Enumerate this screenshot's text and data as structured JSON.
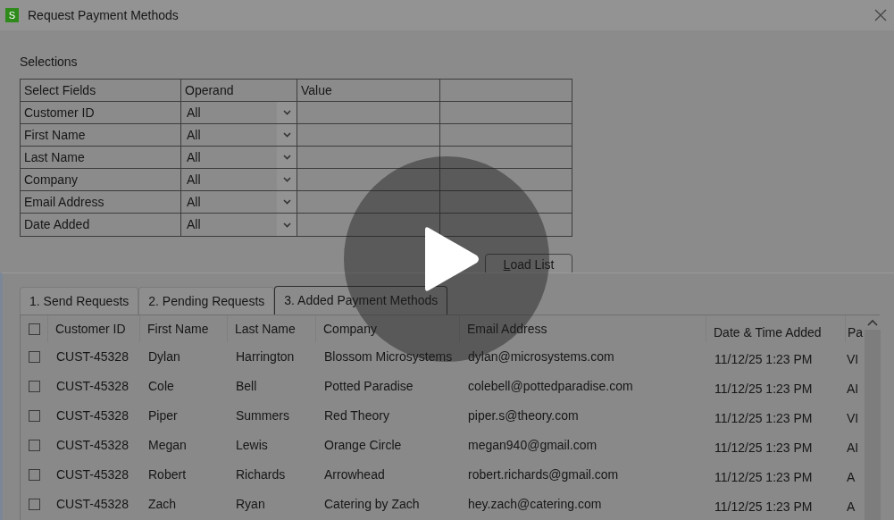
{
  "window": {
    "title": "Request Payment Methods",
    "app_icon": "S"
  },
  "selections": {
    "label": "Selections",
    "columns": [
      "Select Fields",
      "Operand",
      "Value",
      ""
    ],
    "rows": [
      {
        "field": "Customer ID",
        "operand": "All"
      },
      {
        "field": "First Name",
        "operand": "All"
      },
      {
        "field": "Last Name",
        "operand": "All"
      },
      {
        "field": "Company",
        "operand": "All"
      },
      {
        "field": "Email Address",
        "operand": "All"
      },
      {
        "field": "Date Added",
        "operand": "All"
      }
    ]
  },
  "load_button": {
    "label": "Load List"
  },
  "tabs": [
    {
      "label": "1. Send Requests",
      "selected": false
    },
    {
      "label": "2. Pending Requests",
      "selected": false
    },
    {
      "label": "3. Added Payment Methods",
      "selected": true
    }
  ],
  "table": {
    "all_checked": false,
    "columns": [
      "Customer ID",
      "First Name",
      "Last Name",
      "Company",
      "Email Address",
      "Date & Time Added",
      "Pa"
    ],
    "rows": [
      {
        "checked": false,
        "cells": [
          "CUST-45328",
          "Dylan",
          "Harrington",
          "Blossom Microsystems",
          "dylan@microsystems.com",
          "11/12/25 1:23 PM",
          "VI"
        ]
      },
      {
        "checked": false,
        "cells": [
          "CUST-45328",
          "Cole",
          "Bell",
          "Potted Paradise",
          "colebell@pottedparadise.com",
          "11/12/25 1:23 PM",
          "AI"
        ]
      },
      {
        "checked": false,
        "cells": [
          "CUST-45328",
          "Piper",
          "Summers",
          "Red Theory",
          "piper.s@theory.com",
          "11/12/25 1:23 PM",
          "VI"
        ]
      },
      {
        "checked": false,
        "cells": [
          "CUST-45328",
          "Megan",
          "Lewis",
          "Orange Circle",
          "megan940@gmail.com",
          "11/12/25 1:23 PM",
          "AI"
        ]
      },
      {
        "checked": false,
        "cells": [
          "CUST-45328",
          "Robert",
          "Richards",
          "Arrowhead",
          "robert.richards@gmail.com",
          "11/12/25 1:23 PM",
          "A"
        ]
      },
      {
        "checked": false,
        "cells": [
          "CUST-45328",
          "Zach",
          "Ryan",
          "Catering by Zach",
          "hey.zach@catering.com",
          "11/12/25 1:23 PM",
          "A"
        ]
      }
    ]
  }
}
